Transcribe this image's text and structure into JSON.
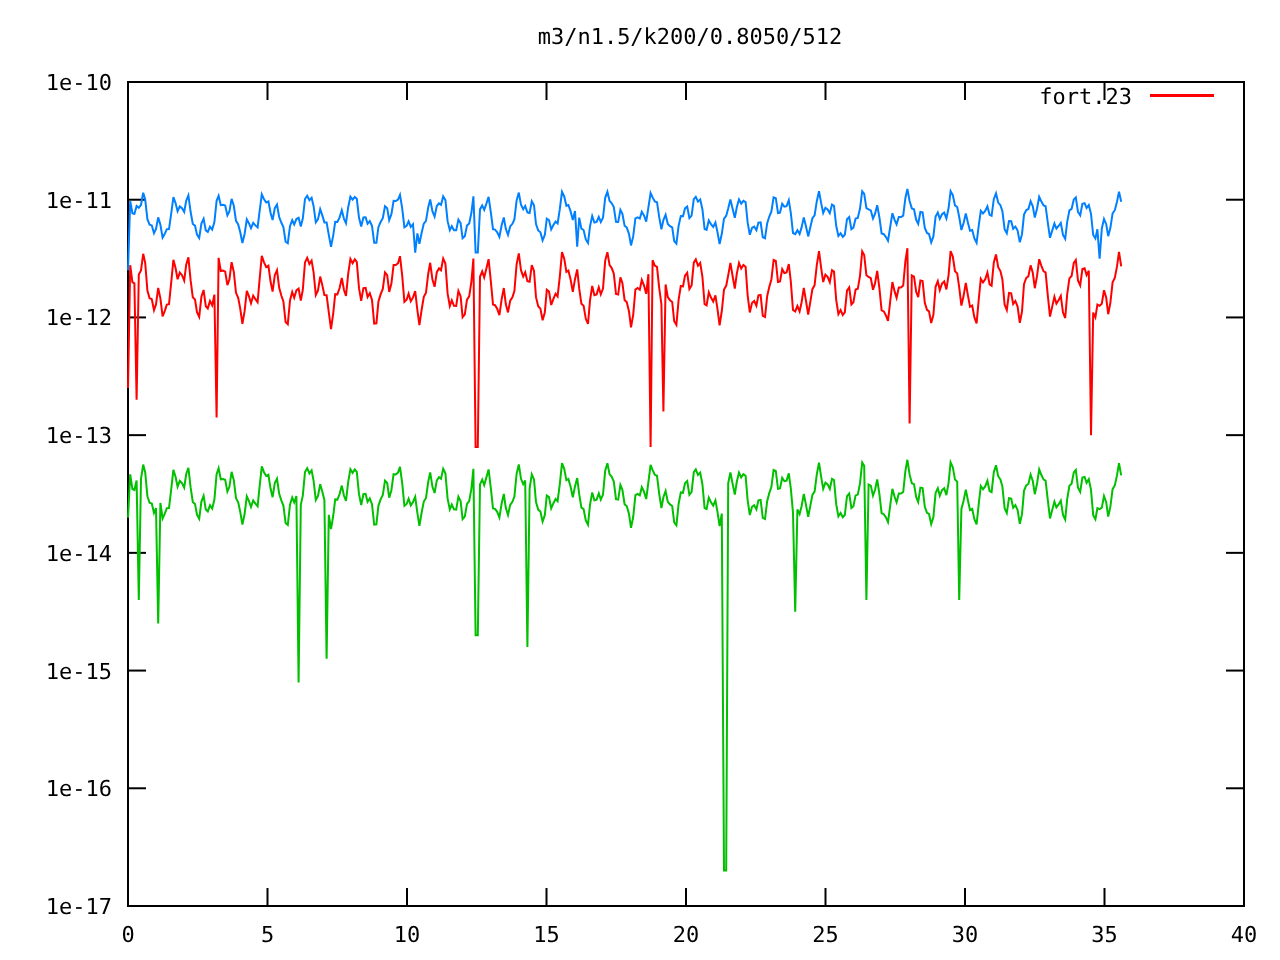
{
  "plot": {
    "title": "m3/n1.5/k200/0.8050/512",
    "y_axis_labels": [
      "1e-10",
      "1e-11",
      "1e-12",
      "1e-13",
      "1e-14",
      "1e-15",
      "1e-16",
      "1e-17"
    ],
    "x_axis_labels": [
      "0",
      "5",
      "10",
      "15",
      "20",
      "25",
      "30",
      "35",
      "40"
    ],
    "legend": [
      {
        "label": "fort.23",
        "color": "#ff0000"
      }
    ]
  }
}
